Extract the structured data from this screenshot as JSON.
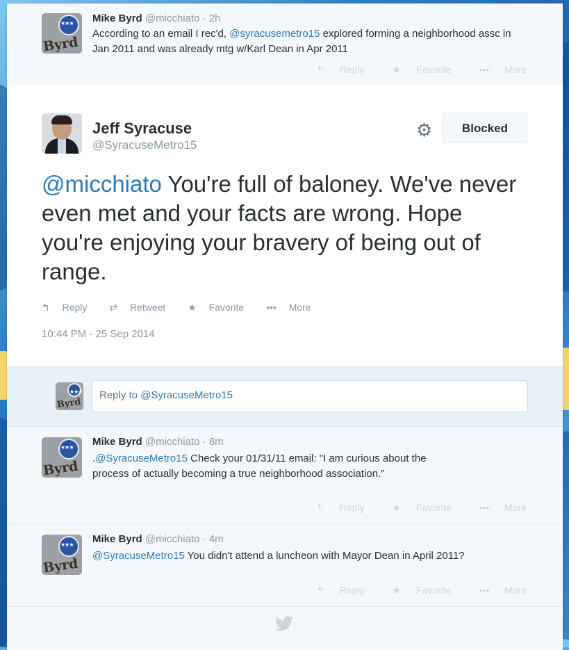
{
  "tweets_top": {
    "name": "Mike Byrd",
    "handle": "@micchiato",
    "time": "2h",
    "text_before": "According to an email I rec'd, ",
    "mention": "@syracusemetro15",
    "text_after": " explored forming a neighborhood assc in Jan 2011 and was already mtg w/Karl Dean in Apr 2011"
  },
  "action_labels": {
    "reply": "Reply",
    "favorite": "Favorite",
    "more": "More",
    "retweet": "Retweet"
  },
  "main": {
    "name": "Jeff Syracuse",
    "handle": "@SyracuseMetro15",
    "blocked": "Blocked",
    "mention": "@micchiato",
    "text": " You're full of baloney.  We've never even met and your facts are wrong.  Hope you're enjoying your bravery of being out of range.",
    "timestamp": "10:44 PM - 25 Sep 2014"
  },
  "reply_box": {
    "placeholder": "Reply to ",
    "mention": "@SyracuseMetro15"
  },
  "replies": [
    {
      "name": "Mike Byrd",
      "handle": "@micchiato",
      "time": "8m",
      "prefix": ".",
      "mention": "@SyracuseMetro15",
      "text": " Check your 01/31/11 email: \"I am curious about the process of actually becoming a true neighborhood association.\""
    },
    {
      "name": "Mike Byrd",
      "handle": "@micchiato",
      "time": "4m",
      "prefix": "",
      "mention": "@SyracuseMetro15",
      "text": " You didn't attend a luncheon with Mayor Dean in April 2011?"
    }
  ],
  "avatar_text": "Byrd",
  "icons": {
    "reply": "reply-icon",
    "retweet": "retweet-icon",
    "favorite": "star-icon",
    "more": "more-icon",
    "settings": "gear-icon",
    "logo": "twitter-bird-icon"
  },
  "colors": {
    "link": "#2b7bb9",
    "muted": "#8899a6",
    "background": "#1f5fa8"
  }
}
